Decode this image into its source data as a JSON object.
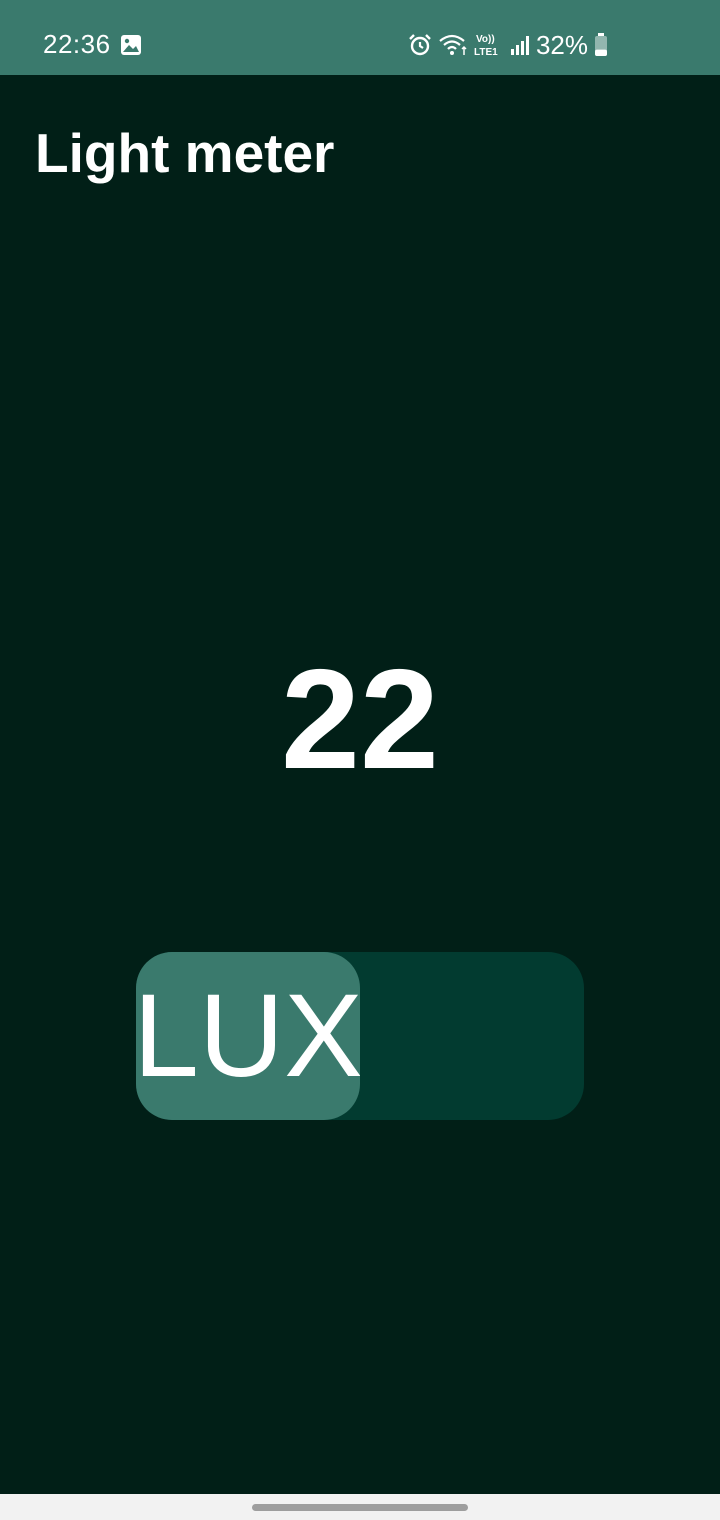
{
  "status_bar": {
    "time": "22:36",
    "network_label": "Vo) LTE1",
    "battery_percent": "32%",
    "battery_level": 0.32,
    "icons": [
      "gallery-icon",
      "alarm-icon",
      "wifi-icon",
      "volte-lte-icon",
      "signal-icon",
      "battery-icon"
    ]
  },
  "header": {
    "title": "Light meter"
  },
  "reading": {
    "value": "22"
  },
  "unit_toggle": {
    "selected_label": "LUX",
    "selected_index": 0,
    "segment_count": 2
  },
  "colors": {
    "background": "#011f17",
    "status_bar": "#3a7a6d",
    "toggle_track": "#023b30",
    "toggle_selected": "#3a7a6d",
    "text": "#ffffff"
  }
}
